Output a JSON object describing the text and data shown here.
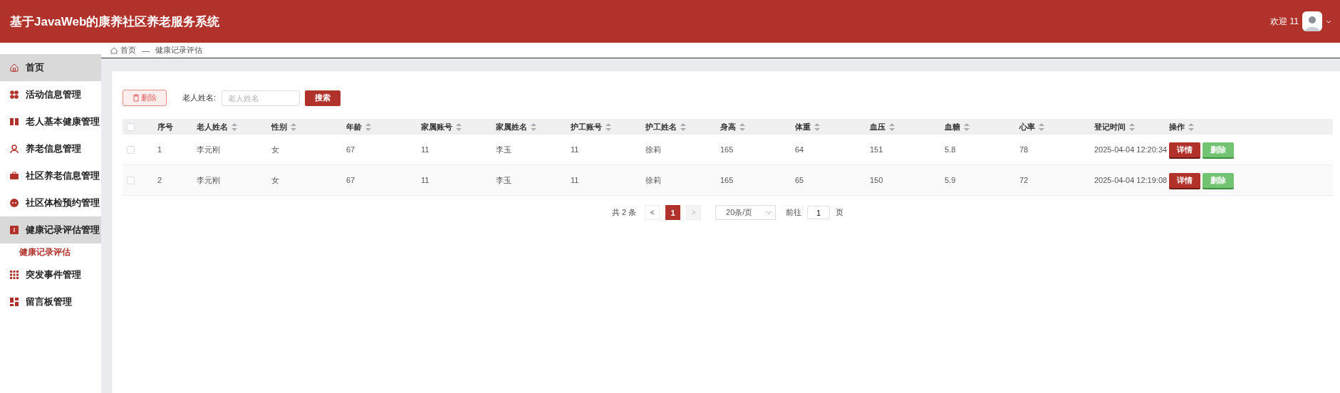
{
  "header": {
    "title": "基于JavaWeb的康养社区养老服务系统",
    "welcome": "欢迎 11"
  },
  "sidebar": {
    "items": [
      {
        "label": "首页",
        "selected": true
      },
      {
        "label": "活动信息管理",
        "selected": false
      },
      {
        "label": "老人基本健康管理",
        "selected": false
      },
      {
        "label": "养老信息管理",
        "selected": false
      },
      {
        "label": "社区养老信息管理",
        "selected": false
      },
      {
        "label": "社区体检预约管理",
        "selected": false
      },
      {
        "label": "健康记录评估管理",
        "selected": true,
        "children": [
          {
            "label": "健康记录评估",
            "selected": true
          }
        ]
      },
      {
        "label": "突发事件管理",
        "selected": false
      },
      {
        "label": "留言板管理",
        "selected": false
      }
    ]
  },
  "breadcrumb": {
    "items": [
      "首页",
      "健康记录评估"
    ],
    "separator": "—"
  },
  "toolbar": {
    "delete_button": "删除",
    "search_label": "老人姓名:",
    "search": {
      "placeholder": "老人姓名"
    },
    "search_button": "搜索"
  },
  "table": {
    "all_checked": false,
    "columns": [
      {
        "label": "序号",
        "sortable": false
      },
      {
        "label": "老人姓名",
        "sortable": true
      },
      {
        "label": "性别",
        "sortable": true
      },
      {
        "label": "年龄",
        "sortable": true
      },
      {
        "label": "家属账号",
        "sortable": true
      },
      {
        "label": "家属姓名",
        "sortable": true
      },
      {
        "label": "护工账号",
        "sortable": true
      },
      {
        "label": "护工姓名",
        "sortable": true
      },
      {
        "label": "身高",
        "sortable": true
      },
      {
        "label": "体重",
        "sortable": true
      },
      {
        "label": "血压",
        "sortable": true
      },
      {
        "label": "血糖",
        "sortable": true
      },
      {
        "label": "心率",
        "sortable": true
      },
      {
        "label": "登记时间",
        "sortable": true
      },
      {
        "label": "操作",
        "sortable": true
      }
    ],
    "rows": [
      {
        "checked": false,
        "cells": [
          "1",
          "李元刚",
          "女",
          "67",
          "11",
          "李玉",
          "11",
          "徐莉",
          "165",
          "64",
          "151",
          "5.8",
          "78",
          "2025-04-04 12:20:34"
        ],
        "actions": [
          {
            "kind": "detail",
            "label": "详情"
          },
          {
            "kind": "delete",
            "label": "删除"
          }
        ]
      },
      {
        "checked": false,
        "cells": [
          "2",
          "李元刚",
          "女",
          "67",
          "11",
          "李玉",
          "11",
          "徐莉",
          "165",
          "65",
          "150",
          "5.9",
          "72",
          "2025-04-04 12:19:08"
        ],
        "actions": [
          {
            "kind": "detail",
            "label": "详情"
          },
          {
            "kind": "delete",
            "label": "删除"
          }
        ]
      }
    ]
  },
  "pagination": {
    "total": "共 2 条",
    "prev": {
      "label": "<",
      "disabled": false
    },
    "pages": [
      {
        "label": "1",
        "selected": true
      }
    ],
    "next": {
      "label": ">",
      "disabled": true
    },
    "page_size": "20条/页",
    "goto_label": "前往",
    "goto_value": "1",
    "goto_unit": "页"
  }
}
